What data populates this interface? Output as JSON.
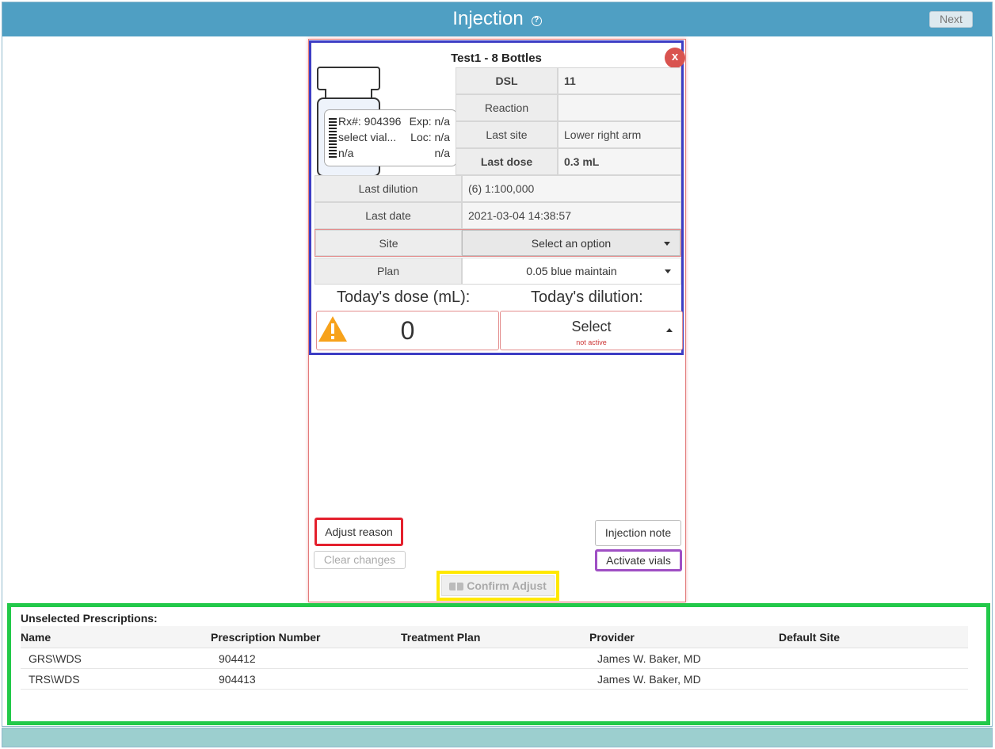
{
  "header": {
    "title": "Injection",
    "help_glyph": "?",
    "next_label": "Next",
    "bar_color": "#4f9fc3"
  },
  "vial": {
    "title": "Test1 - 8 Bottles",
    "close_label": "x",
    "label": {
      "rx": "Rx#: 904396",
      "exp": "Exp: n/a",
      "vial": "select vial...",
      "loc": "Loc: n/a",
      "left3": "n/a",
      "right3": "n/a"
    },
    "info": [
      {
        "key": "DSL",
        "value": "11",
        "bold": true
      },
      {
        "key": "Reaction",
        "value": "",
        "bold": false
      },
      {
        "key": "Last site",
        "value": "Lower right arm",
        "bold": false
      },
      {
        "key": "Last dose",
        "value": "0.3 mL",
        "bold": true
      }
    ],
    "last_dilution": {
      "key": "Last dilution",
      "value": "(6) 1:100,000"
    },
    "last_date": {
      "key": "Last date",
      "value": "2021-03-04 14:38:57"
    },
    "site": {
      "key": "Site",
      "value": "Select an option"
    },
    "plan": {
      "key": "Plan",
      "value": "0.05 blue maintain"
    },
    "today_dose_label": "Today's dose (mL):",
    "today_dilution_label": "Today's dilution:",
    "dose_value": "0",
    "dilution_value": "Select",
    "dilution_status": "not active"
  },
  "actions": {
    "adjust_reason": "Adjust reason",
    "injection_note": "Injection note",
    "clear_changes": "Clear changes",
    "activate_vials": "Activate vials",
    "confirm_adjust": "Confirm Adjust"
  },
  "unselected": {
    "title": "Unselected Prescriptions:",
    "columns": [
      "Name",
      "Prescription Number",
      "Treatment Plan",
      "Provider",
      "Default Site"
    ],
    "rows": [
      {
        "name": "GRS\\WDS",
        "number": "904412",
        "plan": "",
        "provider": "James W. Baker, MD",
        "site": ""
      },
      {
        "name": "TRS\\WDS",
        "number": "904413",
        "plan": "",
        "provider": "James W. Baker, MD",
        "site": ""
      }
    ]
  }
}
